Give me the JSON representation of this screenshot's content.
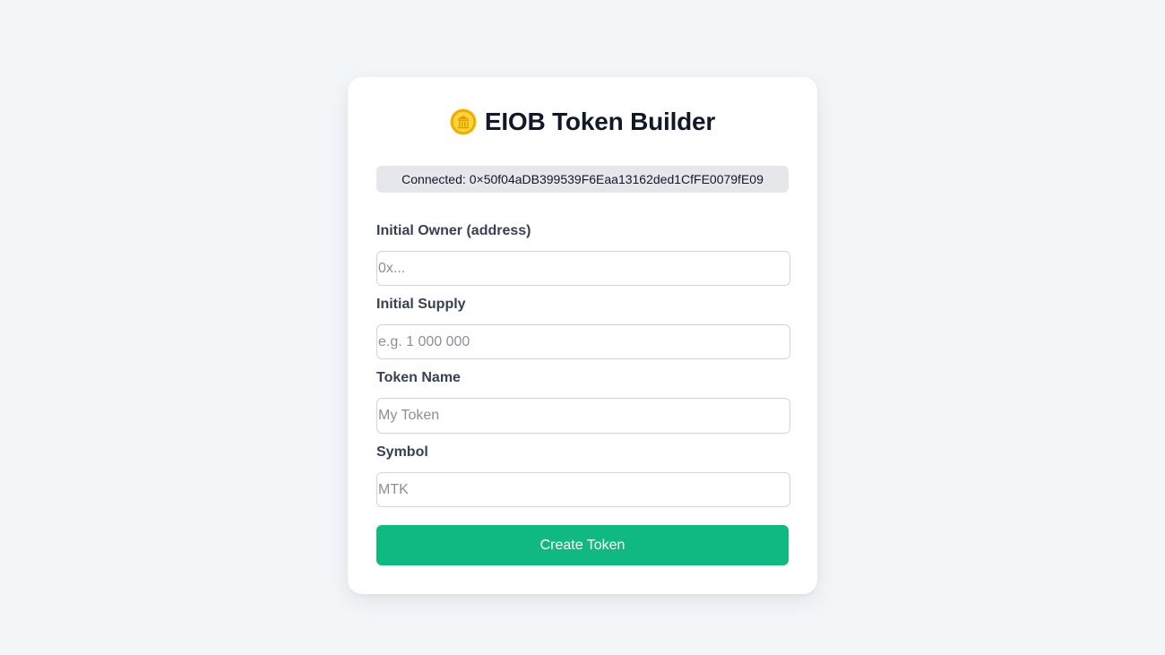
{
  "app": {
    "title_emoji_icon": "coin-icon",
    "title": "EIOB Token Builder"
  },
  "wallet": {
    "connected_label": "Connected:",
    "address": "0×50f04aDB399539F6Eaa13162ded1CfFE0079fE09"
  },
  "form": {
    "owner": {
      "label": "Initial Owner (address)",
      "placeholder": "0x...",
      "value": ""
    },
    "supply": {
      "label": "Initial Supply",
      "placeholder": "e.g. 1 000 000",
      "value": ""
    },
    "name": {
      "label": "Token Name",
      "placeholder": "My Token",
      "value": ""
    },
    "symbol": {
      "label": "Symbol",
      "placeholder": "MTK",
      "value": ""
    },
    "submit_label": "Create Token"
  },
  "colors": {
    "page_background": "#f3f6f9",
    "card_background": "#ffffff",
    "accent": "#10b981",
    "connected_badge": "#e5e7eb"
  }
}
